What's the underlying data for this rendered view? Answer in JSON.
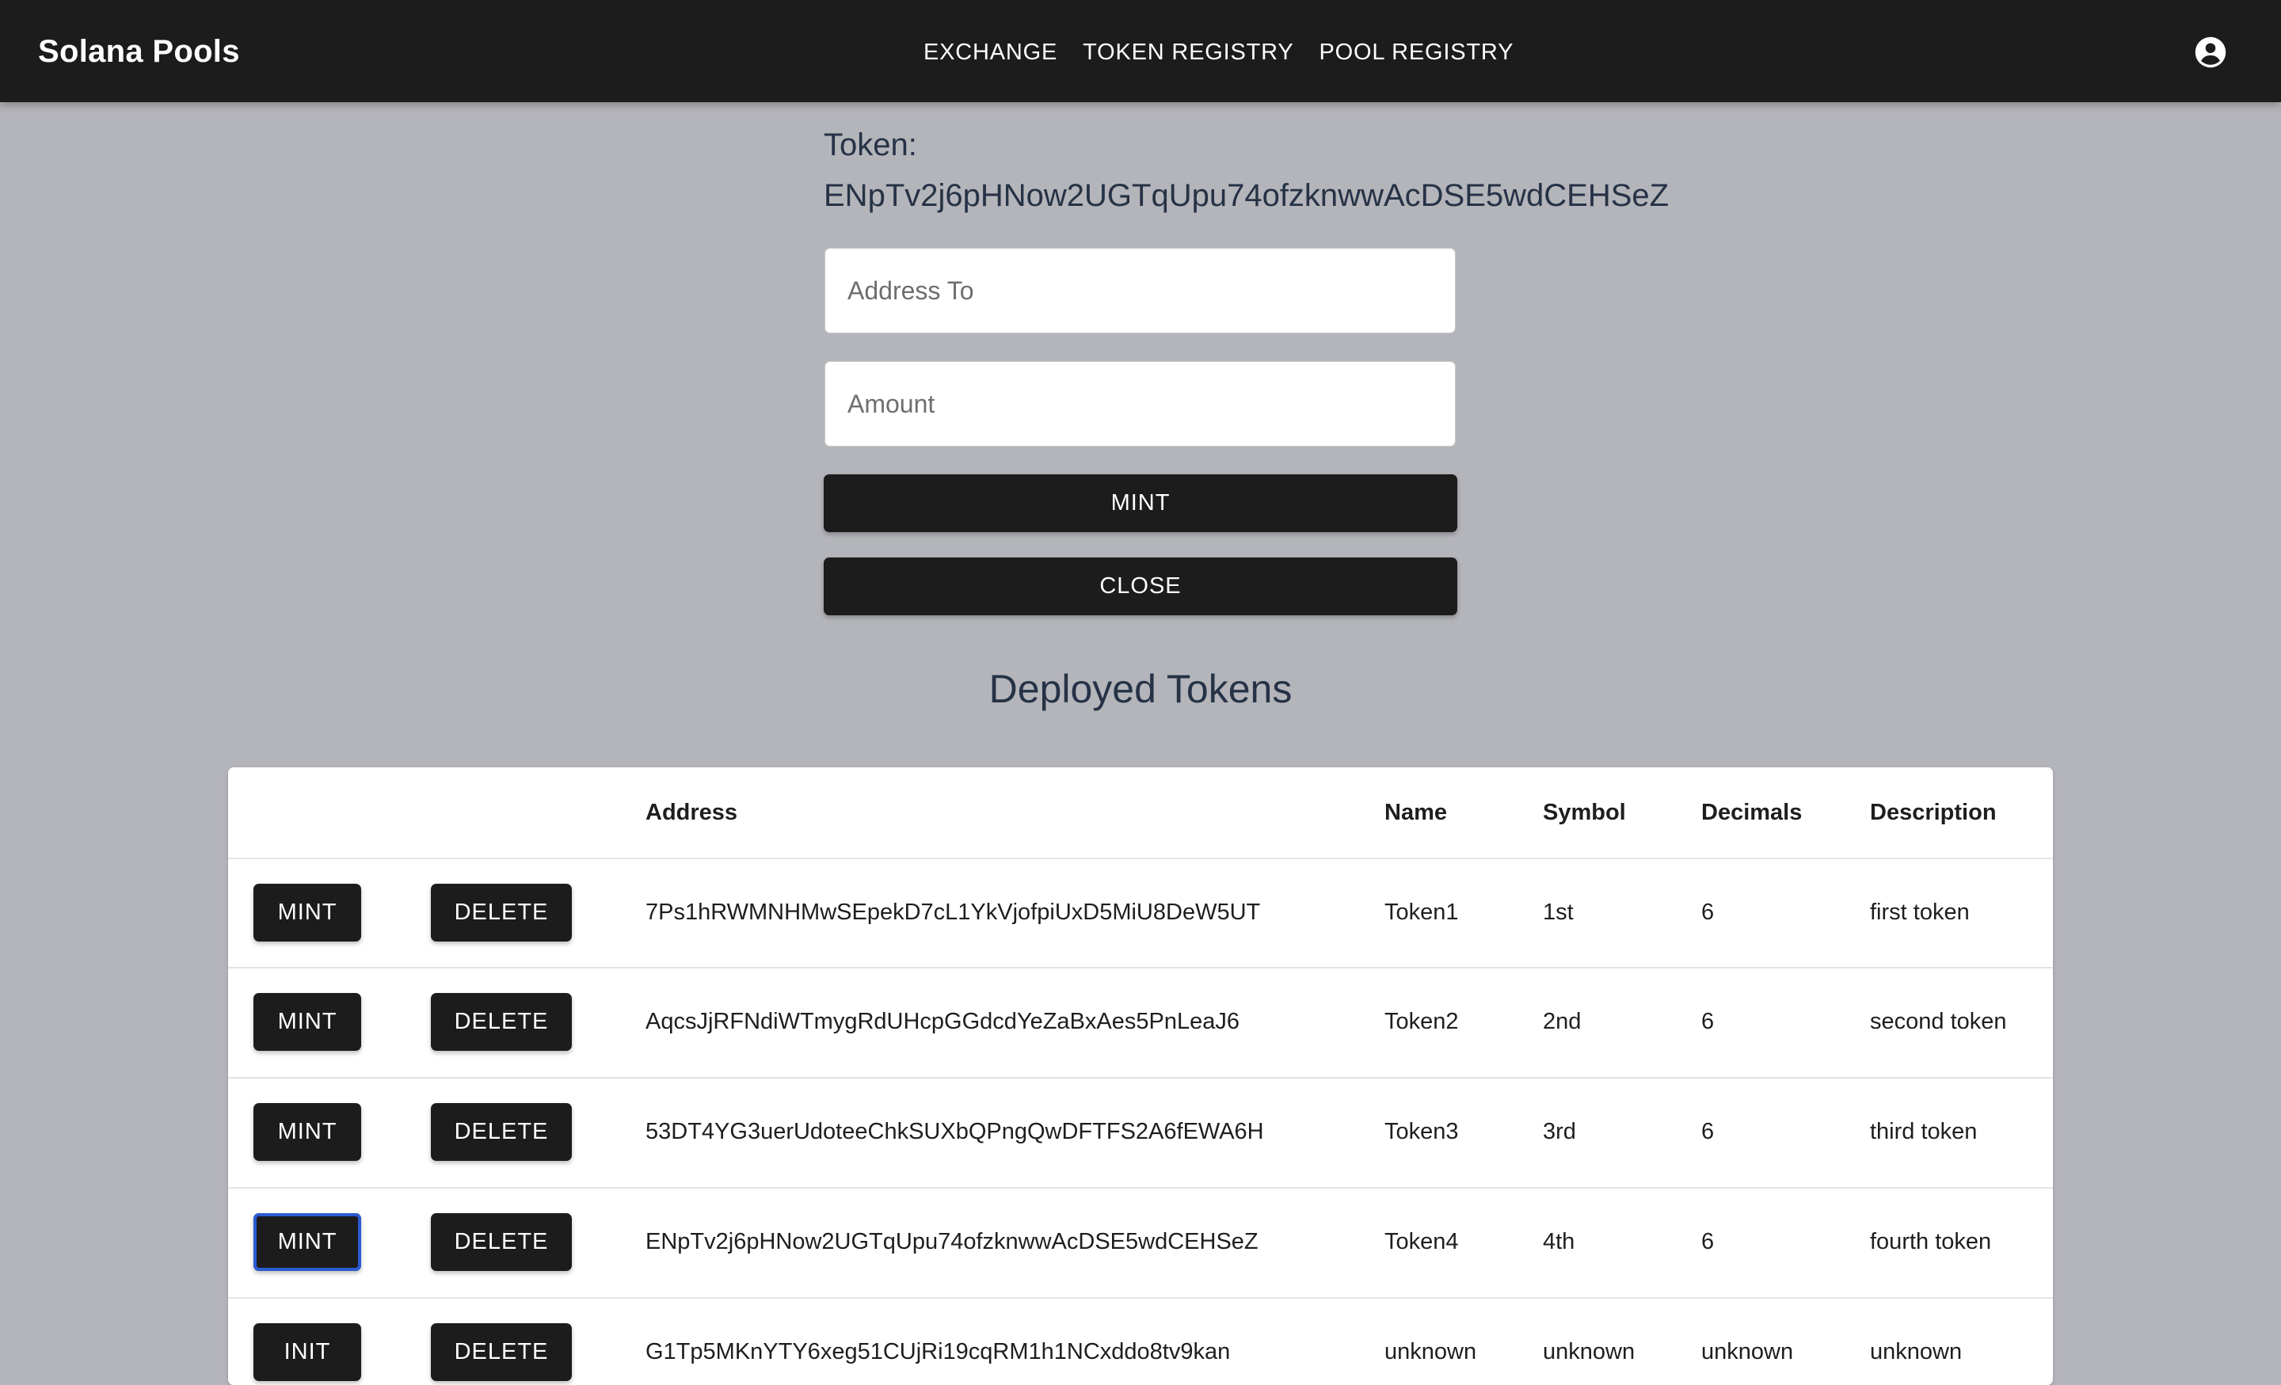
{
  "app": {
    "title": "Solana Pools"
  },
  "nav": {
    "items": [
      "EXCHANGE",
      "TOKEN REGISTRY",
      "POOL REGISTRY"
    ]
  },
  "icons": {
    "account": "account-circle-icon"
  },
  "mint_form": {
    "token_label": "Token:",
    "token_address": "ENpTv2j6pHNow2UGTqUpu74ofzknwwAcDSE5wdCEHSeZ",
    "address_to_placeholder": "Address To",
    "amount_placeholder": "Amount",
    "mint_label": "MINT",
    "close_label": "CLOSE"
  },
  "tokens": {
    "title": "Deployed Tokens",
    "columns": [
      "",
      "",
      "Address",
      "Name",
      "Symbol",
      "Decimals",
      "Description"
    ],
    "rows": [
      {
        "action": "MINT",
        "delete": "DELETE",
        "address": "7Ps1hRWMNHMwSEpekD7cL1YkVjofpiUxD5MiU8DeW5UT",
        "name": "Token1",
        "symbol": "1st",
        "decimals": "6",
        "description": "first token"
      },
      {
        "action": "MINT",
        "delete": "DELETE",
        "address": "AqcsJjRFNdiWTmygRdUHcpGGdcdYeZaBxAes5PnLeaJ6",
        "name": "Token2",
        "symbol": "2nd",
        "decimals": "6",
        "description": "second token"
      },
      {
        "action": "MINT",
        "delete": "DELETE",
        "address": "53DT4YG3uerUdoteeChkSUXbQPngQwDFTFS2A6fEWA6H",
        "name": "Token3",
        "symbol": "3rd",
        "decimals": "6",
        "description": "third token"
      },
      {
        "action": "MINT",
        "delete": "DELETE",
        "address": "ENpTv2j6pHNow2UGTqUpu74ofzknwwAcDSE5wdCEHSeZ",
        "name": "Token4",
        "symbol": "4th",
        "decimals": "6",
        "description": "fourth token"
      },
      {
        "action": "INIT",
        "delete": "DELETE",
        "address": "G1Tp5MKnYTY6xeg51CUjRi19cqRM1h1NCxddo8tv9kan",
        "name": "unknown",
        "symbol": "unknown",
        "decimals": "unknown",
        "description": "unknown"
      }
    ]
  },
  "colors": {
    "background": "#b4b5ba",
    "appbar": "#1c1c1d",
    "button": "#1c1c1d",
    "text_heading": "#263246",
    "focus": "#2a5bd1"
  }
}
